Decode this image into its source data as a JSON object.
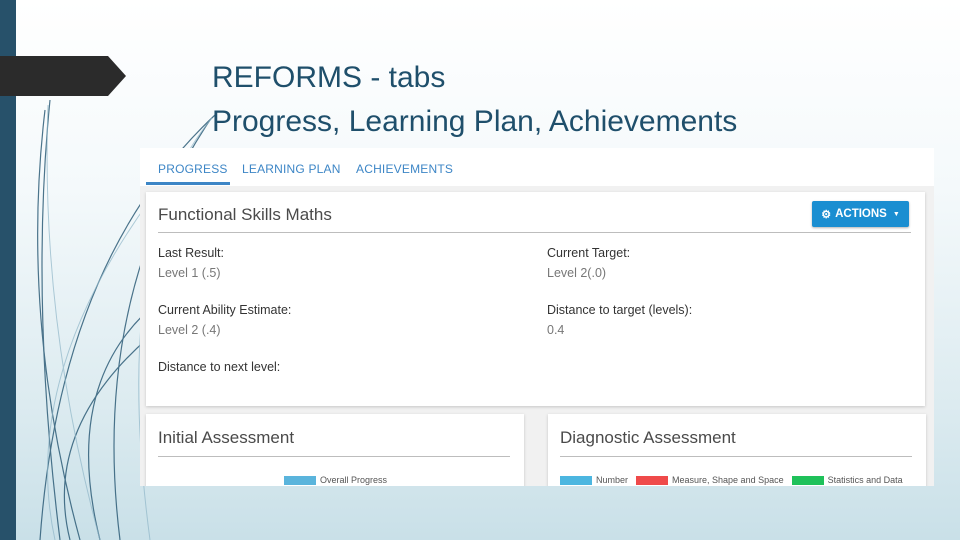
{
  "slide": {
    "title_line1": "REFORMS - tabs",
    "title_line2": "Progress, Learning Plan, Achievements"
  },
  "tabs": [
    {
      "label": "PROGRESS",
      "active": true
    },
    {
      "label": "LEARNING PLAN",
      "active": false
    },
    {
      "label": "ACHIEVEMENTS",
      "active": false
    }
  ],
  "main_card": {
    "title": "Functional Skills Maths",
    "actions_label": "ACTIONS",
    "fields": {
      "last_result_label": "Last Result:",
      "last_result_value": "Level 1 (.5)",
      "current_target_label": "Current Target:",
      "current_target_value": "Level 2(.0)",
      "ability_label": "Current Ability Estimate:",
      "ability_value": "Level 2 (.4)",
      "distance_target_label": "Distance to target (levels):",
      "distance_target_value": "0.4",
      "distance_next_label": "Distance to next level:"
    }
  },
  "initial_card": {
    "title": "Initial Assessment",
    "legend": [
      {
        "label": "Overall Progress",
        "color": "#5ab4dc"
      }
    ]
  },
  "diagnostic_card": {
    "title": "Diagnostic Assessment",
    "legend": [
      {
        "label": "Number",
        "color": "#4cb6e0"
      },
      {
        "label": "Measure, Shape and Space",
        "color": "#ef4a4a"
      },
      {
        "label": "Statistics and Data",
        "color": "#1fc15a"
      }
    ]
  },
  "colors": {
    "accent": "#3d86c6",
    "button": "#1a8ed1",
    "sidebar": "#27516a"
  }
}
